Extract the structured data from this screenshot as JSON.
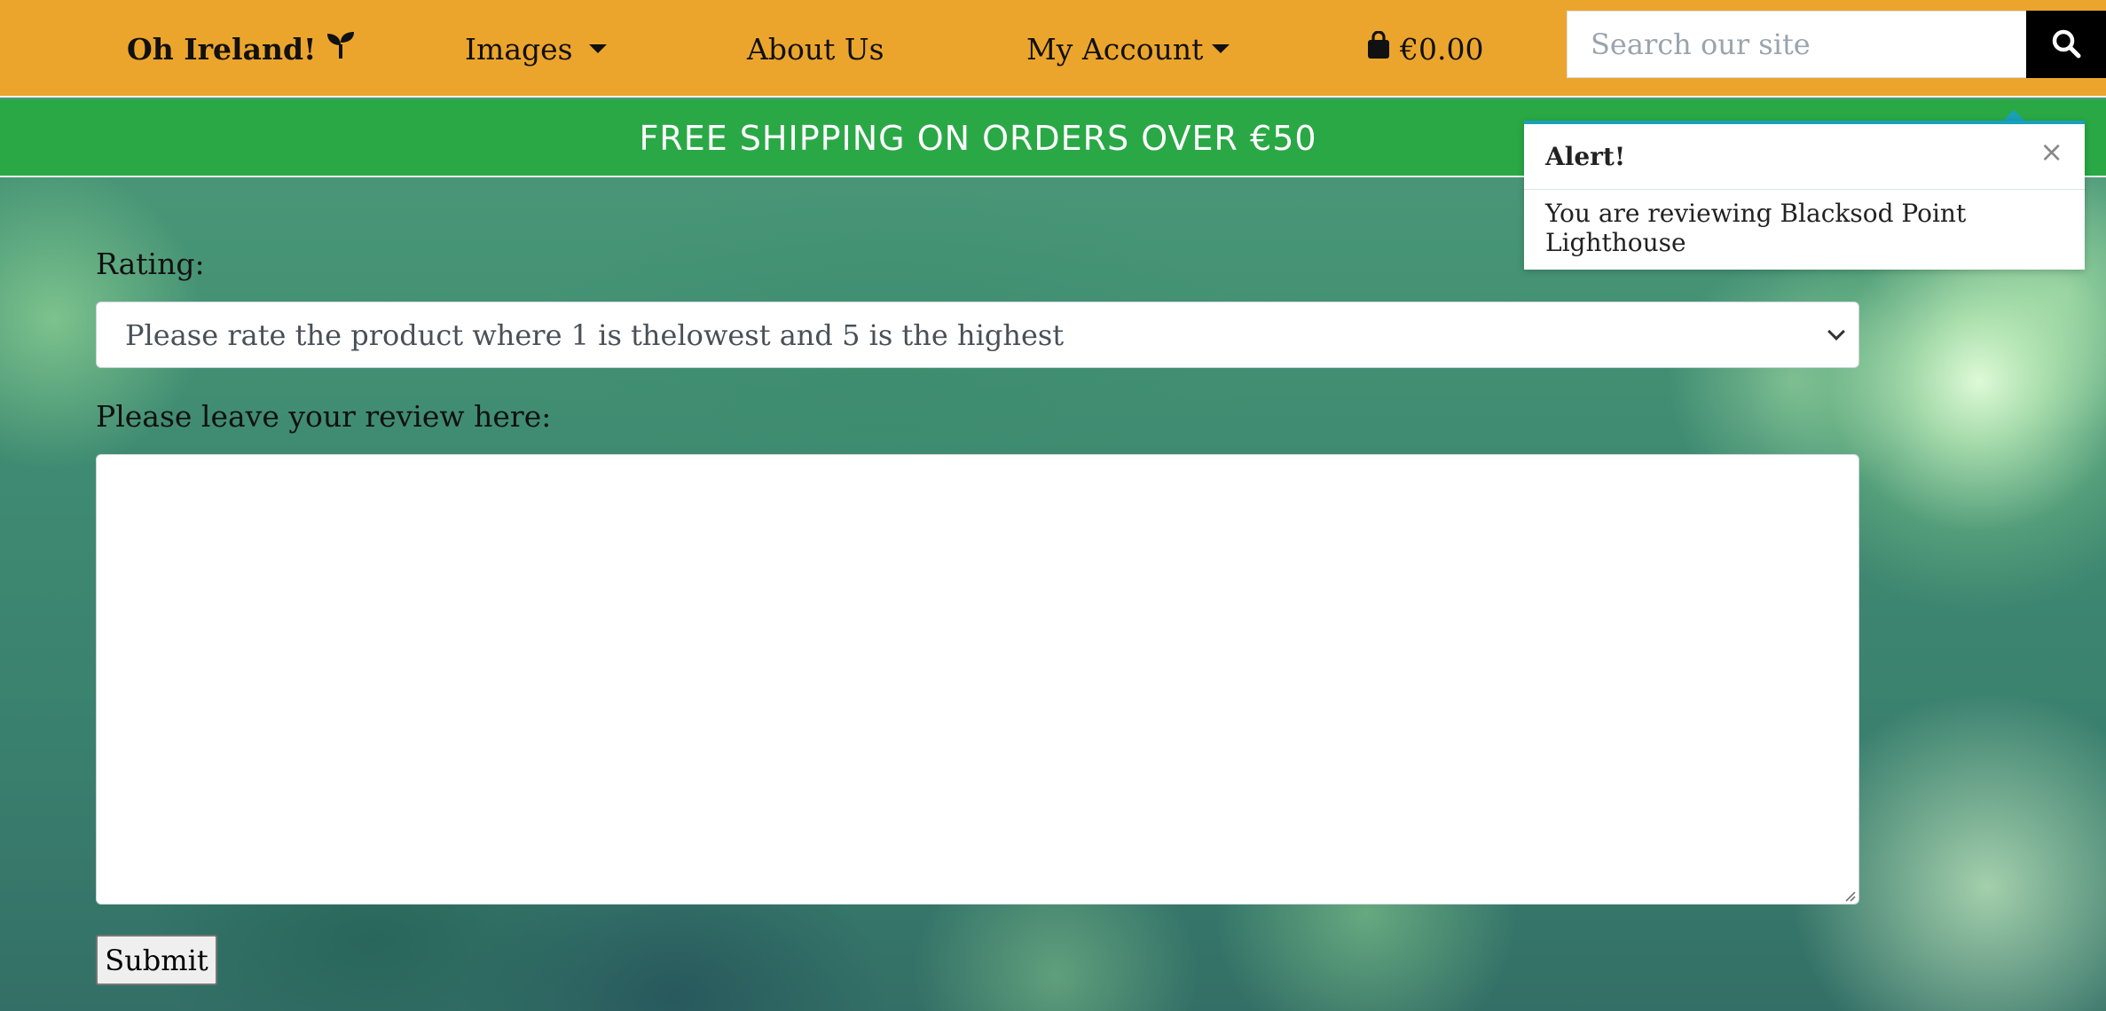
{
  "navbar": {
    "brand": "Oh Ireland!",
    "brand_icon": "seedling-icon",
    "images_label": "Images",
    "about_label": "About Us",
    "account_label": "My Account",
    "cart_total": "€0.00",
    "cart_icon": "shopping-bag-icon",
    "search_placeholder": "Search our site",
    "search_icon": "search-icon",
    "background_color": "#eca52c"
  },
  "banner": {
    "text": "FREE SHIPPING ON ORDERS OVER €50",
    "background_color": "#2aa846"
  },
  "form": {
    "rating_label": "Rating:",
    "rating_selected": "Please rate the product where 1 is thelowest and 5 is the highest",
    "review_label": "Please leave your review here:",
    "review_value": "",
    "submit_label": "Submit"
  },
  "alert": {
    "title": "Alert!",
    "close_symbol": "×",
    "message": "You are reviewing Blacksod Point Lighthouse",
    "accent_color": "#17a2b8"
  }
}
